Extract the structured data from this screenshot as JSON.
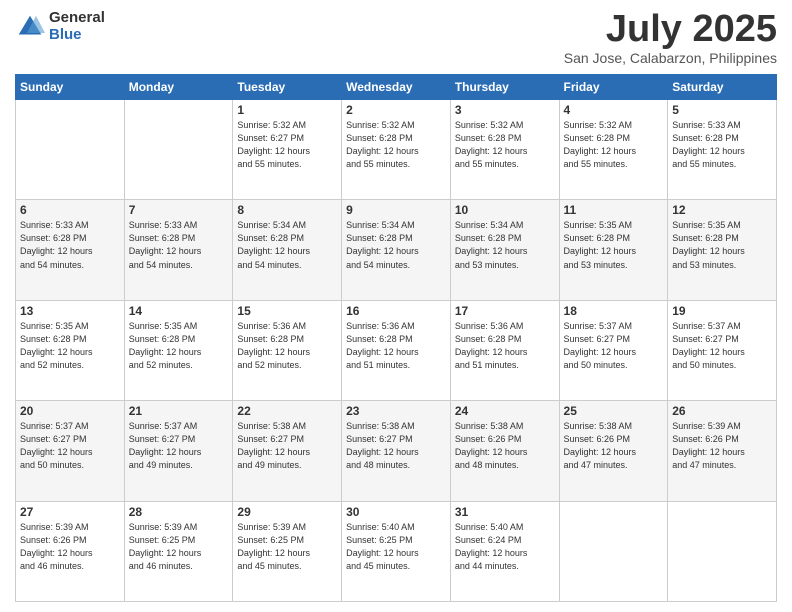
{
  "header": {
    "logo_general": "General",
    "logo_blue": "Blue",
    "title": "July 2025",
    "location": "San Jose, Calabarzon, Philippines"
  },
  "days_of_week": [
    "Sunday",
    "Monday",
    "Tuesday",
    "Wednesday",
    "Thursday",
    "Friday",
    "Saturday"
  ],
  "weeks": [
    [
      {
        "day": "",
        "detail": ""
      },
      {
        "day": "",
        "detail": ""
      },
      {
        "day": "1",
        "detail": "Sunrise: 5:32 AM\nSunset: 6:27 PM\nDaylight: 12 hours\nand 55 minutes."
      },
      {
        "day": "2",
        "detail": "Sunrise: 5:32 AM\nSunset: 6:28 PM\nDaylight: 12 hours\nand 55 minutes."
      },
      {
        "day": "3",
        "detail": "Sunrise: 5:32 AM\nSunset: 6:28 PM\nDaylight: 12 hours\nand 55 minutes."
      },
      {
        "day": "4",
        "detail": "Sunrise: 5:32 AM\nSunset: 6:28 PM\nDaylight: 12 hours\nand 55 minutes."
      },
      {
        "day": "5",
        "detail": "Sunrise: 5:33 AM\nSunset: 6:28 PM\nDaylight: 12 hours\nand 55 minutes."
      }
    ],
    [
      {
        "day": "6",
        "detail": "Sunrise: 5:33 AM\nSunset: 6:28 PM\nDaylight: 12 hours\nand 54 minutes."
      },
      {
        "day": "7",
        "detail": "Sunrise: 5:33 AM\nSunset: 6:28 PM\nDaylight: 12 hours\nand 54 minutes."
      },
      {
        "day": "8",
        "detail": "Sunrise: 5:34 AM\nSunset: 6:28 PM\nDaylight: 12 hours\nand 54 minutes."
      },
      {
        "day": "9",
        "detail": "Sunrise: 5:34 AM\nSunset: 6:28 PM\nDaylight: 12 hours\nand 54 minutes."
      },
      {
        "day": "10",
        "detail": "Sunrise: 5:34 AM\nSunset: 6:28 PM\nDaylight: 12 hours\nand 53 minutes."
      },
      {
        "day": "11",
        "detail": "Sunrise: 5:35 AM\nSunset: 6:28 PM\nDaylight: 12 hours\nand 53 minutes."
      },
      {
        "day": "12",
        "detail": "Sunrise: 5:35 AM\nSunset: 6:28 PM\nDaylight: 12 hours\nand 53 minutes."
      }
    ],
    [
      {
        "day": "13",
        "detail": "Sunrise: 5:35 AM\nSunset: 6:28 PM\nDaylight: 12 hours\nand 52 minutes."
      },
      {
        "day": "14",
        "detail": "Sunrise: 5:35 AM\nSunset: 6:28 PM\nDaylight: 12 hours\nand 52 minutes."
      },
      {
        "day": "15",
        "detail": "Sunrise: 5:36 AM\nSunset: 6:28 PM\nDaylight: 12 hours\nand 52 minutes."
      },
      {
        "day": "16",
        "detail": "Sunrise: 5:36 AM\nSunset: 6:28 PM\nDaylight: 12 hours\nand 51 minutes."
      },
      {
        "day": "17",
        "detail": "Sunrise: 5:36 AM\nSunset: 6:28 PM\nDaylight: 12 hours\nand 51 minutes."
      },
      {
        "day": "18",
        "detail": "Sunrise: 5:37 AM\nSunset: 6:27 PM\nDaylight: 12 hours\nand 50 minutes."
      },
      {
        "day": "19",
        "detail": "Sunrise: 5:37 AM\nSunset: 6:27 PM\nDaylight: 12 hours\nand 50 minutes."
      }
    ],
    [
      {
        "day": "20",
        "detail": "Sunrise: 5:37 AM\nSunset: 6:27 PM\nDaylight: 12 hours\nand 50 minutes."
      },
      {
        "day": "21",
        "detail": "Sunrise: 5:37 AM\nSunset: 6:27 PM\nDaylight: 12 hours\nand 49 minutes."
      },
      {
        "day": "22",
        "detail": "Sunrise: 5:38 AM\nSunset: 6:27 PM\nDaylight: 12 hours\nand 49 minutes."
      },
      {
        "day": "23",
        "detail": "Sunrise: 5:38 AM\nSunset: 6:27 PM\nDaylight: 12 hours\nand 48 minutes."
      },
      {
        "day": "24",
        "detail": "Sunrise: 5:38 AM\nSunset: 6:26 PM\nDaylight: 12 hours\nand 48 minutes."
      },
      {
        "day": "25",
        "detail": "Sunrise: 5:38 AM\nSunset: 6:26 PM\nDaylight: 12 hours\nand 47 minutes."
      },
      {
        "day": "26",
        "detail": "Sunrise: 5:39 AM\nSunset: 6:26 PM\nDaylight: 12 hours\nand 47 minutes."
      }
    ],
    [
      {
        "day": "27",
        "detail": "Sunrise: 5:39 AM\nSunset: 6:26 PM\nDaylight: 12 hours\nand 46 minutes."
      },
      {
        "day": "28",
        "detail": "Sunrise: 5:39 AM\nSunset: 6:25 PM\nDaylight: 12 hours\nand 46 minutes."
      },
      {
        "day": "29",
        "detail": "Sunrise: 5:39 AM\nSunset: 6:25 PM\nDaylight: 12 hours\nand 45 minutes."
      },
      {
        "day": "30",
        "detail": "Sunrise: 5:40 AM\nSunset: 6:25 PM\nDaylight: 12 hours\nand 45 minutes."
      },
      {
        "day": "31",
        "detail": "Sunrise: 5:40 AM\nSunset: 6:24 PM\nDaylight: 12 hours\nand 44 minutes."
      },
      {
        "day": "",
        "detail": ""
      },
      {
        "day": "",
        "detail": ""
      }
    ]
  ]
}
